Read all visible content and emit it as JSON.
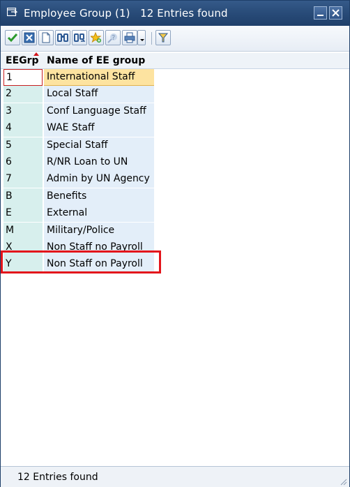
{
  "window": {
    "title": "Employee Group (1)   12 Entries found",
    "colors": {
      "titlebar": "#284b78",
      "selected_row": "#fde3a0",
      "highlight": "#e3141b"
    }
  },
  "toolbar": {
    "buttons": [
      "check-icon",
      "cancel-icon",
      "new-document-icon",
      "find-icon",
      "find-next-icon",
      "favorite-add-icon",
      "help-icon",
      "print-icon",
      "dropdown-icon",
      "filter-icon"
    ]
  },
  "table": {
    "columns": [
      "EEGrp",
      "Name of EE group"
    ],
    "rows": [
      {
        "code": "1",
        "name": "International Staff"
      },
      {
        "code": "2",
        "name": "Local Staff"
      },
      {
        "code": "3",
        "name": "Conf Language Staff"
      },
      {
        "code": "4",
        "name": "WAE Staff"
      },
      {
        "code": "5",
        "name": "Special Staff"
      },
      {
        "code": "6",
        "name": "R/NR Loan to UN"
      },
      {
        "code": "7",
        "name": "Admin by UN Agency"
      },
      {
        "code": "B",
        "name": "Benefits"
      },
      {
        "code": "E",
        "name": "External"
      },
      {
        "code": "M",
        "name": "Military/Police"
      },
      {
        "code": "X",
        "name": "Non Staff no Payroll"
      },
      {
        "code": "Y",
        "name": "Non Staff on Payroll"
      }
    ],
    "selected_index": 0,
    "highlighted_index": 8
  },
  "status": {
    "text": "12 Entries found"
  }
}
